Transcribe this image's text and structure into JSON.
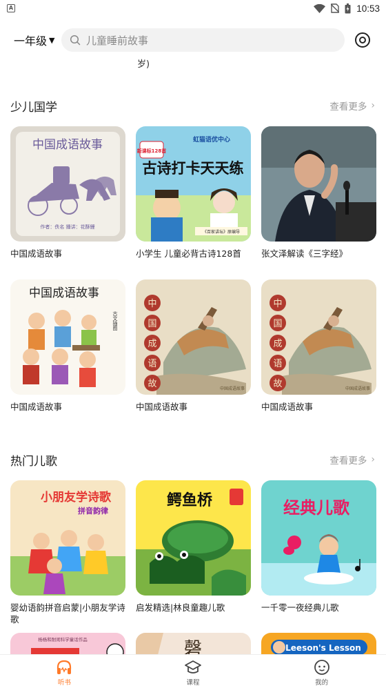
{
  "status_bar": {
    "time": "10:53"
  },
  "header": {
    "grade": "一年级",
    "search_placeholder": "儿童睡前故事",
    "truncated_text": "岁)"
  },
  "sections": [
    {
      "title": "少儿国学",
      "more": "查看更多",
      "items": [
        {
          "title": "中国成语故事",
          "cover_text": "中国成语故事",
          "cover_credit": "作者：佚名    播讲：花酥鲤"
        },
        {
          "title": "小学生 儿童必背古诗128首",
          "cover_text": "古诗打卡天天练",
          "cover_badge": "新课标128首",
          "cover_brand": "虹猫语优中心",
          "cover_sub": "《百家讲坛》原编导"
        },
        {
          "title": "张文泽解读《三字经》"
        },
        {
          "title": "中国成语故事",
          "cover_text": "中国成语故事"
        },
        {
          "title": "中国成语故事",
          "cover_text": "中国成语故事"
        },
        {
          "title": "中国成语故事",
          "cover_text": "中国成语故事"
        }
      ]
    },
    {
      "title": "热门儿歌",
      "more": "查看更多",
      "items": [
        {
          "title": "婴幼语韵拼音启蒙|小朋友学诗歌",
          "cover_text": "小朋友学诗歌",
          "cover_sub": "拼音韵律"
        },
        {
          "title": "启发精选|林良童趣儿歌",
          "cover_text": "鳄鱼桥"
        },
        {
          "title": "一千零一夜经典儿歌",
          "cover_text": "经典儿歌"
        }
      ]
    }
  ],
  "partial_row": [
    {
      "cover_text": "杨杨和耐闹科学童话作品"
    },
    {
      "cover_text": "磬"
    },
    {
      "cover_text": "Leeson's Lesson"
    }
  ],
  "bottom_nav": [
    {
      "label": "听书",
      "icon": "headphones-icon",
      "active": true
    },
    {
      "label": "课程",
      "icon": "graduation-cap-icon",
      "active": false
    },
    {
      "label": "我的",
      "icon": "face-icon",
      "active": false
    }
  ],
  "colors": {
    "accent": "#ff7a29",
    "search_bg": "#f2f2f2",
    "muted": "#9a9a9a"
  }
}
